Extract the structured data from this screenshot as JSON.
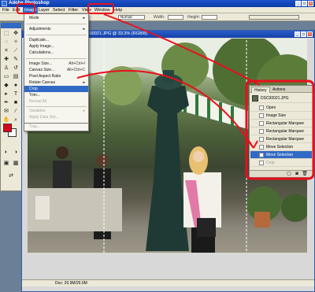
{
  "window": {
    "title": "Adobe Photoshop"
  },
  "menubar": [
    "File",
    "Edit",
    "Image",
    "Layer",
    "Select",
    "Filter",
    "View",
    "Window",
    "Help"
  ],
  "document": {
    "title": "DSC00021.JPG @ 33.3% (RGB/8)",
    "status": "Doc: 26.9M/26.9M"
  },
  "image_menu": {
    "items": [
      {
        "label": "Mode",
        "shortcut": "▸",
        "state": "normal"
      },
      {
        "label": "Adjustments",
        "shortcut": "▸",
        "state": "normal"
      },
      {
        "label": "Duplicate...",
        "shortcut": "",
        "state": "normal"
      },
      {
        "label": "Apply Image...",
        "shortcut": "",
        "state": "normal"
      },
      {
        "label": "Calculations...",
        "shortcut": "",
        "state": "normal"
      },
      {
        "label": "Image Size...",
        "shortcut": "Alt+Ctrl+I",
        "state": "normal"
      },
      {
        "label": "Canvas Size...",
        "shortcut": "Alt+Ctrl+C",
        "state": "normal"
      },
      {
        "label": "Pixel Aspect Ratio",
        "shortcut": "▸",
        "state": "normal"
      },
      {
        "label": "Rotate Canvas",
        "shortcut": "▸",
        "state": "normal"
      },
      {
        "label": "Crop",
        "shortcut": "",
        "state": "highlighted"
      },
      {
        "label": "Trim...",
        "shortcut": "",
        "state": "normal"
      },
      {
        "label": "Reveal All",
        "shortcut": "",
        "state": "disabled"
      },
      {
        "label": "Variables",
        "shortcut": "▸",
        "state": "disabled"
      },
      {
        "label": "Apply Data Set...",
        "shortcut": "",
        "state": "disabled"
      },
      {
        "label": "Trap...",
        "shortcut": "",
        "state": "disabled"
      }
    ]
  },
  "history": {
    "tabs": [
      "History",
      "Actions"
    ],
    "snapshot": "DSC00021.JPG",
    "items": [
      {
        "label": "Open",
        "state": "normal"
      },
      {
        "label": "Image Size",
        "state": "normal"
      },
      {
        "label": "Rectangular Marquee",
        "state": "normal"
      },
      {
        "label": "Rectangular Marquee",
        "state": "normal"
      },
      {
        "label": "Rectangular Marquee",
        "state": "normal"
      },
      {
        "label": "Move Selection",
        "state": "normal"
      },
      {
        "label": "Move Selection",
        "state": "selected"
      },
      {
        "label": "Crop",
        "state": "dimmed"
      }
    ]
  },
  "options": {
    "style_value": "Normal",
    "width_label": "Width:",
    "height_label": "Height:"
  },
  "colors": {
    "accent": "#316ac5",
    "annotation": "#e8101c",
    "foreground": "#e00018",
    "background": "#ffffff"
  }
}
